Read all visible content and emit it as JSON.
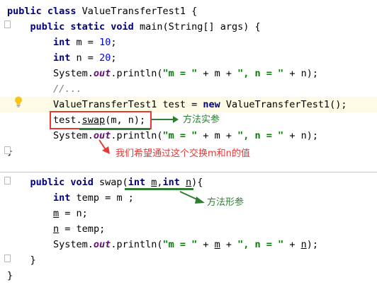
{
  "lines": [
    {
      "segments": [
        {
          "t": "public class ",
          "c": "kw"
        },
        {
          "t": "ValueTransferTest1 {"
        }
      ]
    },
    {
      "segments": [
        {
          "t": "    public static void ",
          "c": "kw"
        },
        {
          "t": "main(String[] args) {"
        }
      ]
    },
    {
      "segments": [
        {
          "t": "        int ",
          "c": "kw"
        },
        {
          "t": "m = "
        },
        {
          "t": "10",
          "c": "num"
        },
        {
          "t": ";"
        }
      ]
    },
    {
      "segments": [
        {
          "t": "        int ",
          "c": "kw"
        },
        {
          "t": "n = "
        },
        {
          "t": "20",
          "c": "num"
        },
        {
          "t": ";"
        }
      ]
    },
    {
      "segments": [
        {
          "t": "        System."
        },
        {
          "t": "out",
          "c": "fld"
        },
        {
          "t": ".println("
        },
        {
          "t": "\"m = \"",
          "c": "str"
        },
        {
          "t": " + m + "
        },
        {
          "t": "\", n = \"",
          "c": "str"
        },
        {
          "t": " + n);"
        }
      ]
    },
    {
      "segments": [
        {
          "t": "        //...",
          "c": "cmt"
        }
      ]
    },
    {
      "segments": [
        {
          "t": "        ValueTransferTest1 test = "
        },
        {
          "t": "new ",
          "c": "kw"
        },
        {
          "t": "ValueTransferTest1();"
        }
      ],
      "highlight": true
    },
    {
      "segments": [
        {
          "t": "        test."
        },
        {
          "t": "swap",
          "c": "ul"
        },
        {
          "t": "(m, n);"
        }
      ]
    },
    {
      "segments": [
        {
          "t": "        System."
        },
        {
          "t": "out",
          "c": "fld"
        },
        {
          "t": ".println("
        },
        {
          "t": "\"m = \"",
          "c": "str"
        },
        {
          "t": " + m + "
        },
        {
          "t": "\", n = \"",
          "c": "str"
        },
        {
          "t": " + n);"
        }
      ]
    },
    {
      "segments": [
        {
          "t": "}"
        }
      ]
    },
    {
      "segments": [
        {
          "t": ""
        }
      ]
    },
    {
      "segments": [
        {
          "t": "    public void ",
          "c": "kw"
        },
        {
          "t": "swap("
        },
        {
          "t": "int ",
          "c": "kw"
        },
        {
          "t": "m",
          "c": "ul"
        },
        {
          "t": ","
        },
        {
          "t": "int ",
          "c": "kw"
        },
        {
          "t": "n",
          "c": "ul"
        },
        {
          "t": "){"
        }
      ]
    },
    {
      "segments": [
        {
          "t": "        int ",
          "c": "kw"
        },
        {
          "t": "temp = m ;"
        }
      ]
    },
    {
      "segments": [
        {
          "t": "        "
        },
        {
          "t": "m",
          "c": "ul"
        },
        {
          "t": " = n;"
        }
      ]
    },
    {
      "segments": [
        {
          "t": "        "
        },
        {
          "t": "n",
          "c": "ul"
        },
        {
          "t": " = temp;"
        }
      ]
    },
    {
      "segments": [
        {
          "t": "        System."
        },
        {
          "t": "out",
          "c": "fld"
        },
        {
          "t": ".println("
        },
        {
          "t": "\"m = \"",
          "c": "str"
        },
        {
          "t": " + "
        },
        {
          "t": "m",
          "c": "ul"
        },
        {
          "t": " + "
        },
        {
          "t": "\", n = \"",
          "c": "str"
        },
        {
          "t": " + "
        },
        {
          "t": "n",
          "c": "ul"
        },
        {
          "t": ");"
        }
      ]
    },
    {
      "segments": [
        {
          "t": "    }"
        }
      ]
    },
    {
      "segments": [
        {
          "t": "}"
        }
      ]
    }
  ],
  "annotations": {
    "actual_params": "方法实参",
    "goal": "我们希望通过这个交换m和n的值",
    "formal_params": "方法形参"
  },
  "colors": {
    "keyword": "#000080",
    "number": "#0000ff",
    "string": "#008000",
    "field": "#660e7a",
    "comment": "#808080",
    "annotation_green": "#2e7d32",
    "annotation_red": "#e53935",
    "current_line": "#fdfbe6"
  },
  "icons": {
    "gutter": "lightbulb-icon"
  }
}
